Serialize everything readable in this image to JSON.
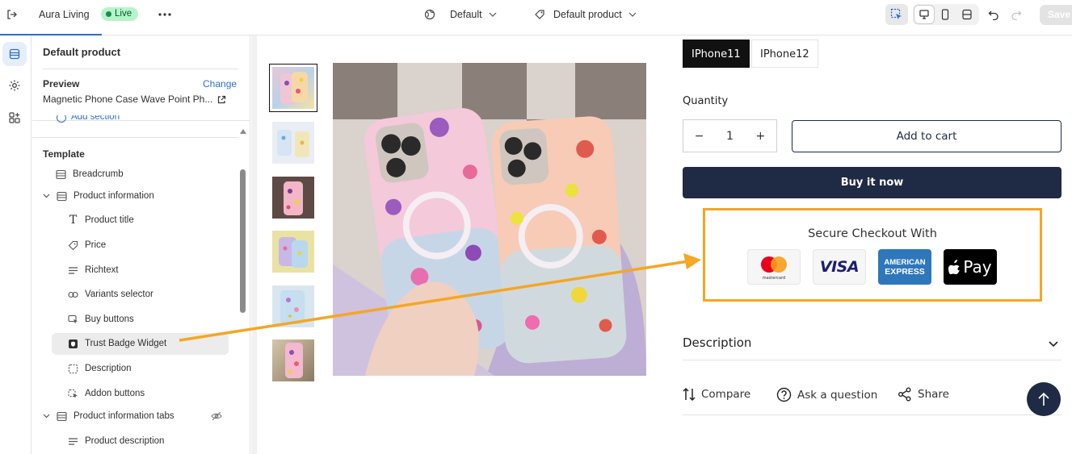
{
  "topbar": {
    "store_name": "Aura Living",
    "status": "Live",
    "theme_selector": "Default",
    "template_selector": "Default product",
    "save_label": "Save"
  },
  "sidebar": {
    "title": "Default product",
    "preview_label": "Preview",
    "change_link": "Change",
    "preview_product": "Magnetic Phone Case Wave Point Ph...",
    "add_section": "Add section",
    "template_heading": "Template",
    "items": [
      {
        "label": "Breadcrumb",
        "icon": "section-icon"
      },
      {
        "label": "Product information",
        "icon": "section-icon"
      },
      {
        "label": "Product title",
        "icon": "text-icon"
      },
      {
        "label": "Price",
        "icon": "price-tag-icon"
      },
      {
        "label": "Richtext",
        "icon": "lines-icon"
      },
      {
        "label": "Variants selector",
        "icon": "variants-icon"
      },
      {
        "label": "Buy buttons",
        "icon": "buy-icon"
      },
      {
        "label": "Trust Badge Widget",
        "icon": "badge-icon"
      },
      {
        "label": "Description",
        "icon": "dashed-box-icon"
      },
      {
        "label": "Addon buttons",
        "icon": "cursor-icon"
      },
      {
        "label": "Product information tabs",
        "icon": "section-icon"
      },
      {
        "label": "Product description",
        "icon": "lines-icon"
      }
    ]
  },
  "product": {
    "variants": [
      "IPhone11",
      "IPhone12"
    ],
    "selected_variant": "IPhone11",
    "quantity_label": "Quantity",
    "quantity_value": "1",
    "minus": "−",
    "plus": "+",
    "add_to_cart": "Add to cart",
    "buy_now": "Buy it now",
    "trust_title": "Secure Checkout With",
    "payment_methods": [
      "mastercard",
      "VISA",
      "AMERICAN",
      "EXPRESS",
      "Pay"
    ],
    "description_label": "Description",
    "actions": [
      "Compare",
      "Ask a question",
      "Share"
    ]
  },
  "colors": {
    "accent": "#2c6ecb",
    "navy": "#1f2a44",
    "highlight": "#f5a623",
    "live_bg": "#b4f5c8"
  }
}
